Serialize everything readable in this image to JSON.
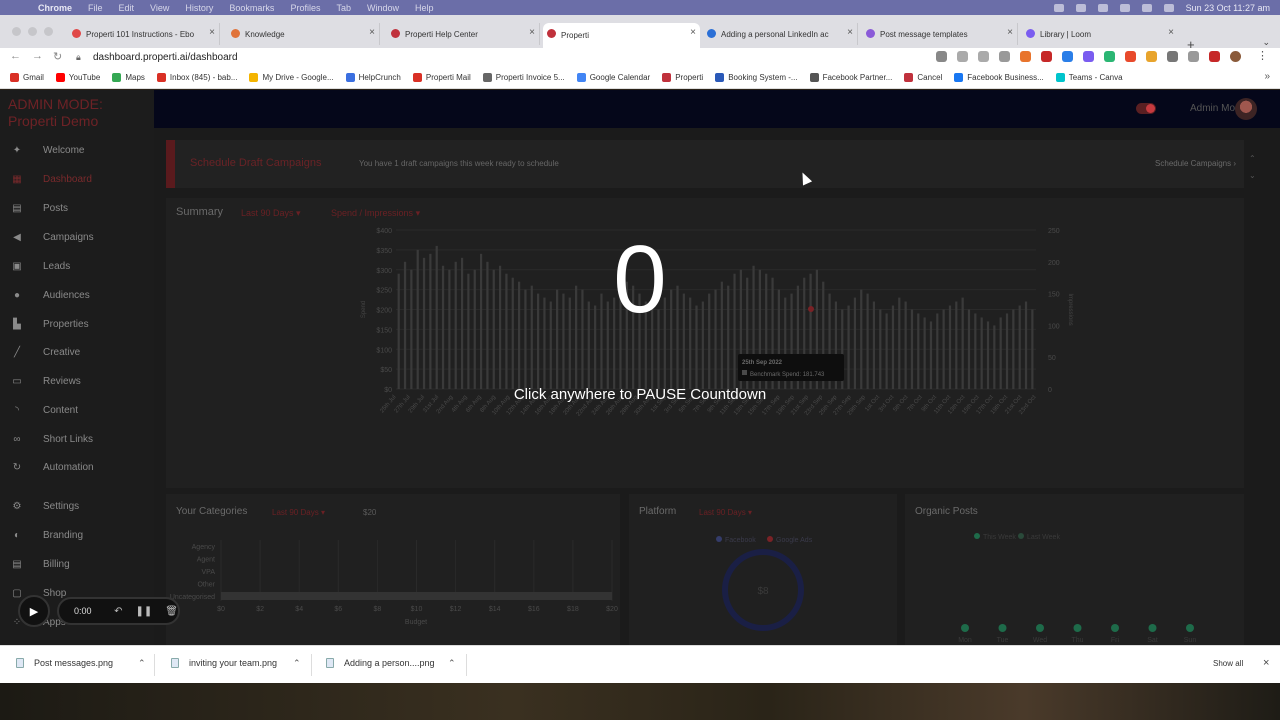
{
  "menubar": {
    "app": "Chrome",
    "items": [
      "File",
      "Edit",
      "View",
      "History",
      "Bookmarks",
      "Profiles",
      "Tab",
      "Window",
      "Help"
    ],
    "datetime": "Sun 23 Oct  11:27 am"
  },
  "tabs": [
    {
      "label": "Properti 101 Instructions - Ebo",
      "favicon_color": "#e04848"
    },
    {
      "label": "Knowledge",
      "favicon_color": "#e0733a"
    },
    {
      "label": "Properti Help Center",
      "favicon_color": "#c0313c"
    },
    {
      "label": "Properti",
      "favicon_color": "#c0313c",
      "active": true
    },
    {
      "label": "Adding a personal LinkedIn ac",
      "favicon_color": "#2b6fd6"
    },
    {
      "label": "Post message templates",
      "favicon_color": "#8a5ad8"
    },
    {
      "label": "Library | Loom",
      "favicon_color": "#7a5cf0"
    }
  ],
  "address": {
    "url": "dashboard.properti.ai/dashboard"
  },
  "bookmarks": [
    {
      "label": "Gmail",
      "color": "#d93025"
    },
    {
      "label": "YouTube",
      "color": "#ff0000"
    },
    {
      "label": "Maps",
      "color": "#34a853"
    },
    {
      "label": "Inbox (845) - bab...",
      "color": "#d93025"
    },
    {
      "label": "My Drive - Google...",
      "color": "#f4b400"
    },
    {
      "label": "HelpCrunch",
      "color": "#3b6fe0"
    },
    {
      "label": "Properti Mail",
      "color": "#d93025"
    },
    {
      "label": "Properti Invoice 5...",
      "color": "#666666"
    },
    {
      "label": "Google Calendar",
      "color": "#4285f4"
    },
    {
      "label": "Properti",
      "color": "#c0313c"
    },
    {
      "label": "Booking System -...",
      "color": "#2a59b8"
    },
    {
      "label": "Facebook Partner...",
      "color": "#555555"
    },
    {
      "label": "Cancel",
      "color": "#c0313c"
    },
    {
      "label": "Facebook Business...",
      "color": "#1877f2"
    },
    {
      "label": "Teams - Canva",
      "color": "#00c4cc"
    }
  ],
  "sidebar": {
    "title_line1": "ADMIN MODE:",
    "title_line2": "Properti Demo",
    "items": [
      {
        "label": "Welcome",
        "icon": "walk-icon",
        "glyph": "✦"
      },
      {
        "label": "Dashboard",
        "icon": "grid-icon",
        "glyph": "▦",
        "active": true
      },
      {
        "label": "Posts",
        "icon": "posts-icon",
        "glyph": "▤"
      },
      {
        "label": "Campaigns",
        "icon": "megaphone-icon",
        "glyph": "◀"
      },
      {
        "label": "Leads",
        "icon": "leads-icon",
        "glyph": "▣"
      },
      {
        "label": "Audiences",
        "icon": "person-icon",
        "glyph": "●"
      },
      {
        "label": "Properties",
        "icon": "building-icon",
        "glyph": "▙"
      },
      {
        "label": "Creative",
        "icon": "brush-icon",
        "glyph": "╱"
      },
      {
        "label": "Reviews",
        "icon": "reviews-icon",
        "glyph": "▭"
      },
      {
        "label": "Content",
        "icon": "rss-icon",
        "glyph": "◝"
      },
      {
        "label": "Short Links",
        "icon": "link-icon",
        "glyph": "∞"
      },
      {
        "label": "Automation",
        "icon": "refresh-icon",
        "glyph": "↻"
      },
      {
        "label": "Settings",
        "icon": "gear-icon",
        "glyph": "⚙"
      },
      {
        "label": "Branding",
        "icon": "palette-icon",
        "glyph": "◐"
      },
      {
        "label": "Billing",
        "icon": "billing-icon",
        "glyph": "▤"
      },
      {
        "label": "Shop",
        "icon": "shop-icon",
        "glyph": "▢"
      },
      {
        "label": "Apps",
        "icon": "apps-icon",
        "glyph": "⁘"
      }
    ]
  },
  "topbar": {
    "admin_mode_label": "Admin Mode"
  },
  "banner": {
    "title": "Schedule Draft Campaigns",
    "text": "You have 1 draft campaigns this week ready to schedule",
    "link": "Schedule Campaigns"
  },
  "summary": {
    "title": "Summary",
    "filter_period": "Last 90 Days",
    "filter_metric": "Spend / Impressions"
  },
  "chart_data": {
    "type": "bar",
    "ylabel": "Spend",
    "y2label": "Impressions",
    "ylim": [
      0,
      400
    ],
    "y2lim": [
      0,
      250
    ],
    "y_ticks": [
      "$0",
      "$50",
      "$100",
      "$150",
      "$200",
      "$250",
      "$300",
      "$350",
      "$400"
    ],
    "y2_ticks": [
      "0",
      "50",
      "100",
      "150",
      "200",
      "250"
    ],
    "x_ticks": [
      "25th Jul",
      "27th Jul",
      "29th Jul",
      "31st Jul",
      "2nd Aug",
      "4th Aug",
      "6th Aug",
      "8th Aug",
      "10th Aug",
      "12th Aug",
      "14th Aug",
      "16th Aug",
      "18th Aug",
      "20th Aug",
      "22nd Aug",
      "24th Aug",
      "26th Aug",
      "28th Aug",
      "30th Aug",
      "1st Sep",
      "3rd Sep",
      "5th Sep",
      "7th Sep",
      "9th Sep",
      "11th Sep",
      "13th Sep",
      "15th Sep",
      "17th Sep",
      "19th Sep",
      "21st Sep",
      "23rd Sep",
      "25th Sep",
      "27th Sep",
      "29th Sep",
      "1st Oct",
      "3rd Oct",
      "5th Oct",
      "7th Oct",
      "9th Oct",
      "11th Oct",
      "13th Oct",
      "15th Oct",
      "17th Oct",
      "19th Oct",
      "21st Oct",
      "23rd Oct"
    ],
    "series": [
      {
        "name": "Benchmark Spend",
        "values": [
          290,
          320,
          300,
          350,
          330,
          340,
          360,
          310,
          300,
          320,
          330,
          290,
          300,
          340,
          320,
          300,
          310,
          290,
          280,
          270,
          250,
          260,
          240,
          230,
          220,
          250,
          240,
          230,
          260,
          250,
          220,
          210,
          240,
          220,
          230,
          250,
          270,
          260,
          240,
          220,
          210,
          200,
          230,
          250,
          260,
          240,
          230,
          210,
          220,
          240,
          250,
          270,
          260,
          290,
          300,
          280,
          310,
          300,
          290,
          280,
          250,
          230,
          240,
          260,
          280,
          290,
          300,
          270,
          240,
          220,
          200,
          210,
          230,
          250,
          240,
          220,
          200,
          190,
          210,
          230,
          220,
          200,
          190,
          180,
          170,
          190,
          200,
          210,
          220,
          230,
          200,
          190,
          180,
          170,
          160,
          180,
          190,
          200,
          210,
          220,
          200
        ]
      }
    ],
    "tooltip": {
      "date": "25th Sep 2022",
      "label": "Benchmark Spend: 181.743"
    },
    "legend": [
      "Impressions",
      "Spend",
      "Benchmark Spend"
    ],
    "legend_colors": [
      "#7a2226",
      "#343c6a",
      "#4a4a4a"
    ],
    "legend_position": "bottom",
    "grid": true
  },
  "categories": {
    "title": "Your Categories",
    "filter": "Last 90 Days",
    "amount": "$20",
    "labels": [
      "Agency",
      "Agent",
      "VPA",
      "Other",
      "Uncategorised"
    ],
    "x_ticks": [
      "$0",
      "$2",
      "$4",
      "$6",
      "$8",
      "$10",
      "$12",
      "$14",
      "$16",
      "$18",
      "$20"
    ],
    "xlabel": "Budget",
    "uncategorised_value": 20
  },
  "platform": {
    "title": "Platform",
    "filter": "Last 90 Days",
    "legend": [
      "Facebook",
      "Google Ads"
    ],
    "center_value": "$8",
    "share": 1.0
  },
  "organic": {
    "title": "Organic Posts",
    "legend": [
      "This Week",
      "Last Week"
    ],
    "days": [
      "Mon",
      "Tue",
      "Wed",
      "Thu",
      "Fri",
      "Sat",
      "Sun"
    ]
  },
  "overlay": {
    "countdown": "0",
    "message": "Click anywhere to PAUSE Countdown"
  },
  "loom": {
    "timer": "0:00"
  },
  "downloads": {
    "files": [
      "Post messages.png",
      "inviting your team.png",
      "Adding a person....png"
    ],
    "show_all": "Show all"
  }
}
